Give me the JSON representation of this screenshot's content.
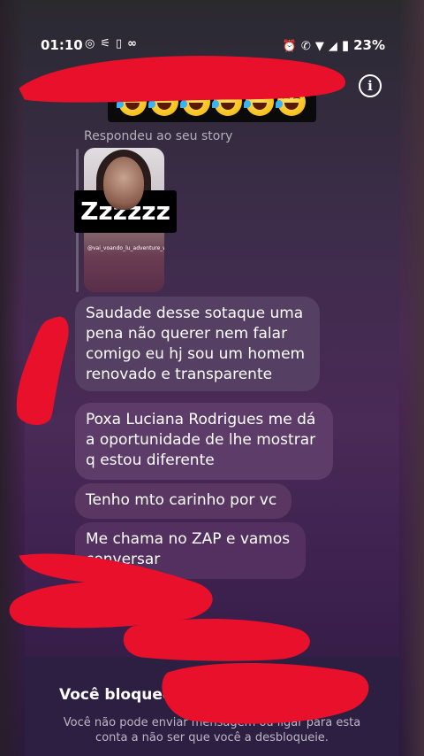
{
  "status_bar": {
    "time": "01:10",
    "battery": "23%",
    "left_icons": [
      "instagram-icon",
      "wifi-calling-icon",
      "phone-icon",
      "voicemail-icon"
    ],
    "right_icons": [
      "alarm-icon",
      "call-icon",
      "wifi-icon",
      "signal-icon",
      "battery-icon"
    ]
  },
  "header": {
    "info_icon": "info-icon",
    "reaction_emojis": [
      "🤣",
      "🤣",
      "🤣",
      "🤣",
      "🤣",
      "🤣"
    ]
  },
  "story_reply": {
    "label": "Respondeu ao seu story",
    "caption": "Zzzzzz",
    "handle": "@vai_voando_lu_adventure_world"
  },
  "messages": [
    "Saudade desse sotaque uma pena não querer nem falar comigo eu hj sou um homem renovado e transparente",
    "Poxa Luciana Rodrigues me dá a oportunidade de lhe mostrar q estou diferente",
    "Tenho mto carinho por vc",
    "Me chama no ZAP e vamos conversar"
  ],
  "blocked_notice": {
    "title": "Você bloqueo",
    "description": "Você não pode enviar mensagem ou ligar para esta conta a não ser que você a desbloqueie."
  },
  "colors": {
    "redaction": "#e8102a",
    "bubble": "#5a4768",
    "background_top": "#2b2a33",
    "background_bottom": "#2c1b3e"
  }
}
